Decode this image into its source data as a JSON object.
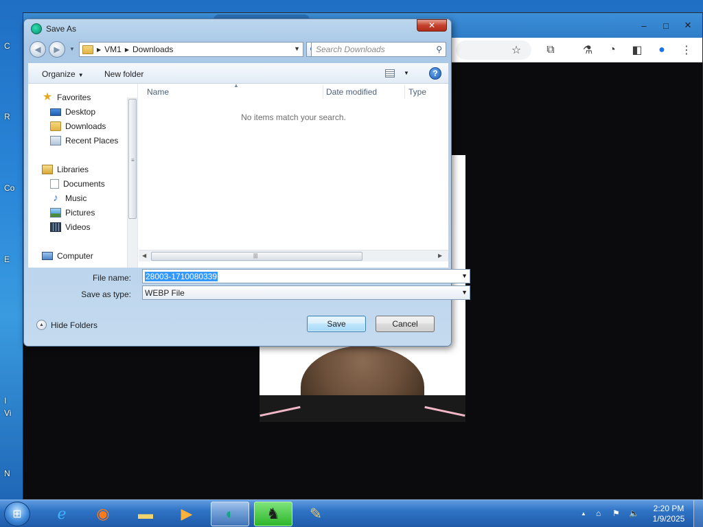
{
  "desktop": {
    "edge_letters": [
      "C",
      "R",
      "Co",
      "E",
      "I",
      "Vi",
      "N"
    ]
  },
  "browser": {
    "window_controls": {
      "minimize": "‒",
      "maximize": "□",
      "close": "✕"
    }
  },
  "dialog": {
    "title": "Save As",
    "close_symbol": "✕",
    "breadcrumb": [
      "VM1",
      "Downloads"
    ],
    "search_placeholder": "Search Downloads",
    "toolbar": {
      "organize_label": "Organize",
      "new_folder_label": "New folder"
    },
    "nav_pane": {
      "groups": [
        {
          "label": "Favorites",
          "icon": "star-icon",
          "items": [
            {
              "label": "Desktop",
              "icon": "desktop-icon"
            },
            {
              "label": "Downloads",
              "icon": "downloads-folder-icon"
            },
            {
              "label": "Recent Places",
              "icon": "recent-places-icon"
            }
          ]
        },
        {
          "label": "Libraries",
          "icon": "libraries-icon",
          "items": [
            {
              "label": "Documents",
              "icon": "documents-icon"
            },
            {
              "label": "Music",
              "icon": "music-icon"
            },
            {
              "label": "Pictures",
              "icon": "pictures-icon"
            },
            {
              "label": "Videos",
              "icon": "videos-icon"
            }
          ]
        },
        {
          "label": "Computer",
          "icon": "computer-icon",
          "items": []
        }
      ]
    },
    "columns": [
      "Name",
      "Date modified",
      "Type"
    ],
    "empty_message": "No items match your search.",
    "file_name_label": "File name:",
    "file_name_value": "28003-1710080339",
    "save_type_label": "Save as type:",
    "save_type_value": "WEBP File",
    "hide_folders_label": "Hide Folders",
    "save_button": "Save",
    "cancel_button": "Cancel"
  },
  "taskbar": {
    "apps": [
      {
        "name": "internet-explorer",
        "icon": "internet-explorer-icon"
      },
      {
        "name": "firefox",
        "icon": "firefox-icon"
      },
      {
        "name": "file-explorer",
        "icon": "file-explorer-icon"
      },
      {
        "name": "media-player",
        "icon": "media-player-icon"
      },
      {
        "name": "active-app",
        "icon": "app-icon"
      },
      {
        "name": "counter-strike",
        "icon": "counter-strike-icon"
      },
      {
        "name": "paint",
        "icon": "paint-icon"
      }
    ],
    "clock_time": "2:20 PM",
    "clock_date": "1/9/2025"
  }
}
